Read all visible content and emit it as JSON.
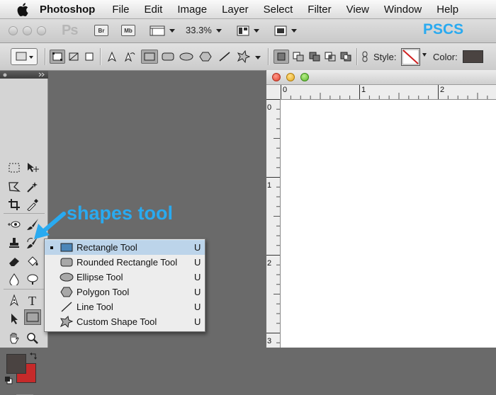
{
  "menubar": {
    "app_name": "Photoshop",
    "items": [
      "File",
      "Edit",
      "Image",
      "Layer",
      "Select",
      "Filter",
      "View",
      "Window",
      "Help"
    ]
  },
  "appbar": {
    "logo": "Ps",
    "bridge_label": "Br",
    "minibridge_label": "Mb",
    "zoom": "33.3%",
    "version_label": "PSCS"
  },
  "options_bar": {
    "style_label": "Style:",
    "color_label": "Color:",
    "color_value": "#4a4341"
  },
  "tools": {
    "foreground_color": "#4a4341",
    "background_color": "#c62a2a",
    "active_tool": "shapes-tool"
  },
  "annotation": {
    "callout_text": "shapes tool",
    "accent_color": "#29aaf0"
  },
  "flyout": {
    "items": [
      {
        "label": "Rectangle Tool",
        "shortcut": "U",
        "icon": "rectangle-icon",
        "selected": true
      },
      {
        "label": "Rounded Rectangle Tool",
        "shortcut": "U",
        "icon": "rounded-rectangle-icon",
        "selected": false
      },
      {
        "label": "Ellipse Tool",
        "shortcut": "U",
        "icon": "ellipse-icon",
        "selected": false
      },
      {
        "label": "Polygon Tool",
        "shortcut": "U",
        "icon": "polygon-icon",
        "selected": false
      },
      {
        "label": "Line Tool",
        "shortcut": "U",
        "icon": "line-icon",
        "selected": false
      },
      {
        "label": "Custom Shape Tool",
        "shortcut": "U",
        "icon": "custom-shape-icon",
        "selected": false
      }
    ]
  },
  "document": {
    "h_ruler_labels": [
      "0",
      "1",
      "2"
    ],
    "v_ruler_labels": [
      "0",
      "1",
      "2",
      "3"
    ]
  }
}
